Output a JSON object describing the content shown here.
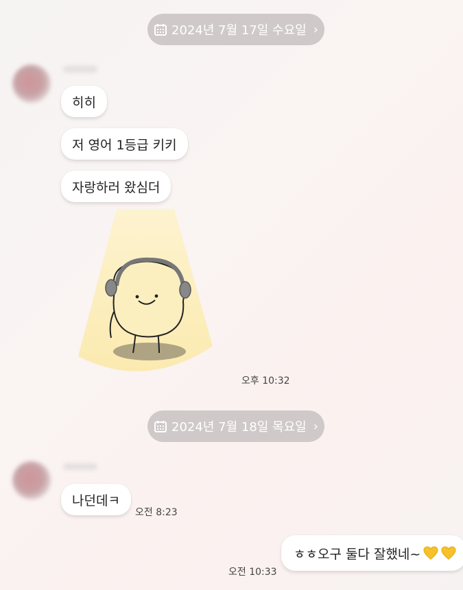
{
  "day1": {
    "date_label": "2024년 7월 17일 수요일",
    "messages": [
      "히히",
      "저 영어 1등급 키키",
      "자랑하러 왔심더"
    ],
    "sticker_time": "오후 10:32"
  },
  "day2": {
    "date_label": "2024년 7월 18일 목요일",
    "incoming_message": "나던데ㅋ",
    "incoming_time": "오전 8:23",
    "outgoing_message": "ㅎㅎ오구 둘다 잘했네~",
    "outgoing_time": "오전 10:33"
  },
  "colors": {
    "heart": "#f6c129",
    "date_pill": "#cfcac9",
    "spotlight": "#fbeeb7"
  },
  "icons": [
    "calendar-icon",
    "chevron-right-icon",
    "yellow-heart-icon"
  ]
}
